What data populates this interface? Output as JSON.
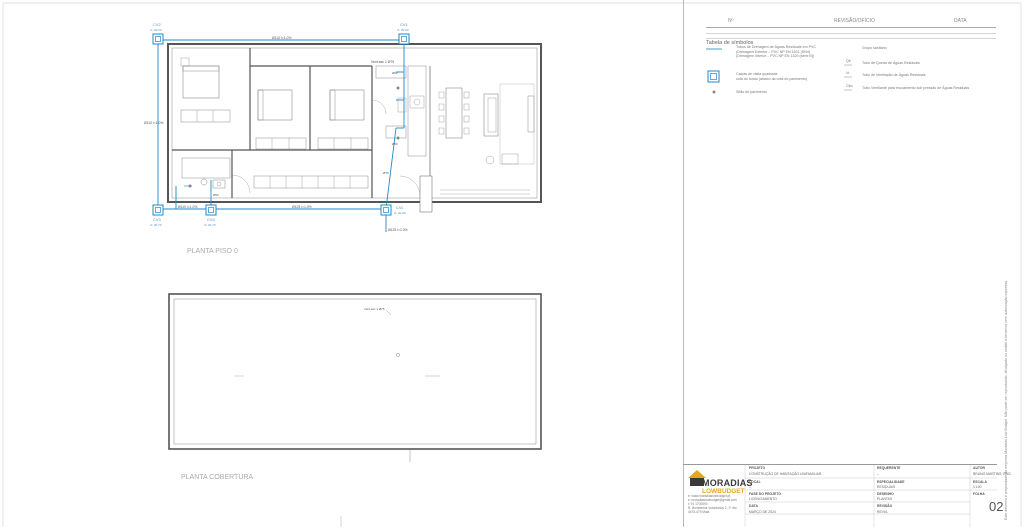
{
  "drawing": {
    "plan_ground_title": "PLANTA PISO 0",
    "plan_roof_title": "PLANTA COBERTURA",
    "boxes": [
      {
        "code": "CV2",
        "level": "ct: 00.00"
      },
      {
        "code": "CV1",
        "level": "ct: 00.00"
      },
      {
        "code": "CV3",
        "level": "ct: 00.70"
      },
      {
        "code": "CV4",
        "level": "ct: 00.70"
      },
      {
        "code": "CVL",
        "level": "ct: 00.00"
      }
    ],
    "pipe_labels": {
      "top": "Ø110 i=1.0%",
      "left": "Ø110 i=1.0%",
      "bottom_left": "Ø110 i=1.0%",
      "bottom_mid": "Ø125 i=1.0%",
      "outlet": "Ø125 i=1.0%",
      "vent": "Vent.asc 1 Ø75",
      "roof_vent": "Vent.asc 1 Ø75",
      "inner_a": "Ø90",
      "inner_b": "Ø50",
      "inner_c": "Ø50",
      "inner_d": "Ø75"
    }
  },
  "revision_table": {
    "col_no": "Nº",
    "col_desc": "REVISÃO/OFÍCIO",
    "col_date": "DATA"
  },
  "legend": {
    "title": "Tabela de símbolos",
    "items": [
      {
        "text": "Tubos de Drenagem de Águas Residuais em PVC\n(Drenagem Exterior – PVC NP EN 1401 (SN4)\n(Drenagem Interior – PVC NP EN 1329 (série B))"
      },
      {
        "text": "Caixas de visita quadrada\ncota do fundo (abaixo da cota do pavimento)"
      },
      {
        "text": "Sifão de pavimento"
      }
    ],
    "items_right": [
      {
        "text": "Grupo sanitário"
      },
      {
        "code": "Qb",
        "text": "Tubo de Queda de Águas Residuais"
      },
      {
        "code": "Vr",
        "text": "Tubo de Ventilação de Águas Residuais"
      },
      {
        "code": "Clkv",
        "text": "Tubo Ventilante para escoamento sob pressão de Águas Residuais"
      }
    ]
  },
  "side_note": "Este desenho é propriedade da empresa Moradias Low Budget. Não pode ser reproduzido, divulgado ou cedido a terceiros sem autorização expressa.",
  "title_block": {
    "brand": "MORADIAS",
    "brand_sub": "LOWBUDGET",
    "contact": "e: www.moradiaslowbudget.pt\ne: moradiaslowbudget@gmail.com\nt: 91 1700590\nR. Bombeiros Voluntários 2, 1º dto\n4475-479 Maia",
    "projeto_label": "PROJETO",
    "projeto_value": "CONSTRUÇÃO DE HABITAÇÃO UNIFAMILIAR",
    "local_label": "LOCAL",
    "local_value": "–",
    "fase_label": "FASE DO PROJETO",
    "fase_value": "LICENCIAMENTO",
    "data_label": "DATA",
    "data_value": "MARÇO DE 2024",
    "requerente_label": "REQUERENTE",
    "requerente_value": "–",
    "especialidade_label": "ESPECIALIDADE",
    "especialidade_value": "RESIDUAIS",
    "desenho_label": "DESENHO",
    "desenho_value": "PLANTAS",
    "revisao_label": "REVISÃO",
    "revisao_value": "REV01",
    "autor_label": "AUTOR",
    "autor_value": "BRUNO MARTINS, ENG.",
    "escala_label": "ESCALA",
    "escala_value": "1:100",
    "folha_label": "FOLHA",
    "sheet_number": "02"
  },
  "colors": {
    "pipe": "#1e88c8",
    "wall": "#555555",
    "furniture": "#8a8a8a",
    "logo_accent": "#e7a61d"
  }
}
